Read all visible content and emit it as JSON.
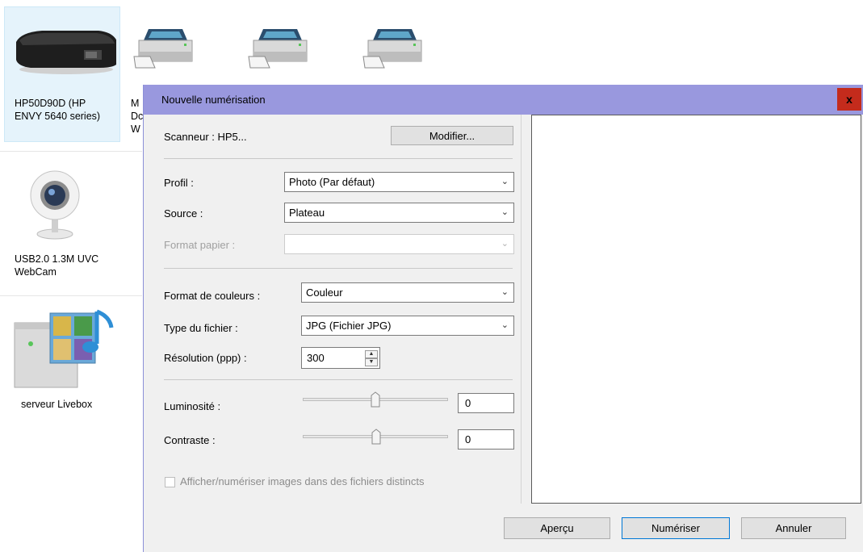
{
  "devices": [
    {
      "name": "hp-printer",
      "label_line1": "HP50D90D (HP",
      "label_line2": "ENVY 5640 series)"
    },
    {
      "name": "partial-device",
      "label_line1": "M",
      "label_line2": "Dc",
      "label_line3": "W"
    },
    {
      "name": "webcam",
      "label_line1": "USB2.0 1.3M UVC",
      "label_line2": "WebCam"
    },
    {
      "name": "livebox-server",
      "label_line1": "serveur Livebox"
    }
  ],
  "dialog": {
    "title": "Nouvelle numérisation",
    "close_label": "x",
    "scanner_label": "Scanneur : HP5...",
    "modify_button": "Modifier...",
    "profile_label": "Profil :",
    "profile_value": "Photo (Par défaut)",
    "source_label": "Source :",
    "source_value": "Plateau",
    "paper_label": "Format papier :",
    "paper_value": "",
    "color_label": "Format de couleurs :",
    "color_value": "Couleur",
    "filetype_label": "Type du fichier :",
    "filetype_value": "JPG (Fichier JPG)",
    "resolution_label": "Résolution (ppp) :",
    "resolution_value": "300",
    "brightness_label": "Luminosité :",
    "brightness_value": "0",
    "contrast_label": "Contraste :",
    "contrast_value": "0",
    "separate_files_label": "Afficher/numériser images dans des fichiers distincts",
    "preview_button": "Aperçu",
    "scan_button": "Numériser",
    "cancel_button": "Annuler"
  },
  "icons": {
    "printer": "printer-icon",
    "webcam": "webcam-icon",
    "media_server": "media-server-icon",
    "chevron": "chevron-down-icon"
  },
  "colors": {
    "titlebar": "#9998de",
    "close": "#c42b1c",
    "selection": "#e5f3fb"
  }
}
